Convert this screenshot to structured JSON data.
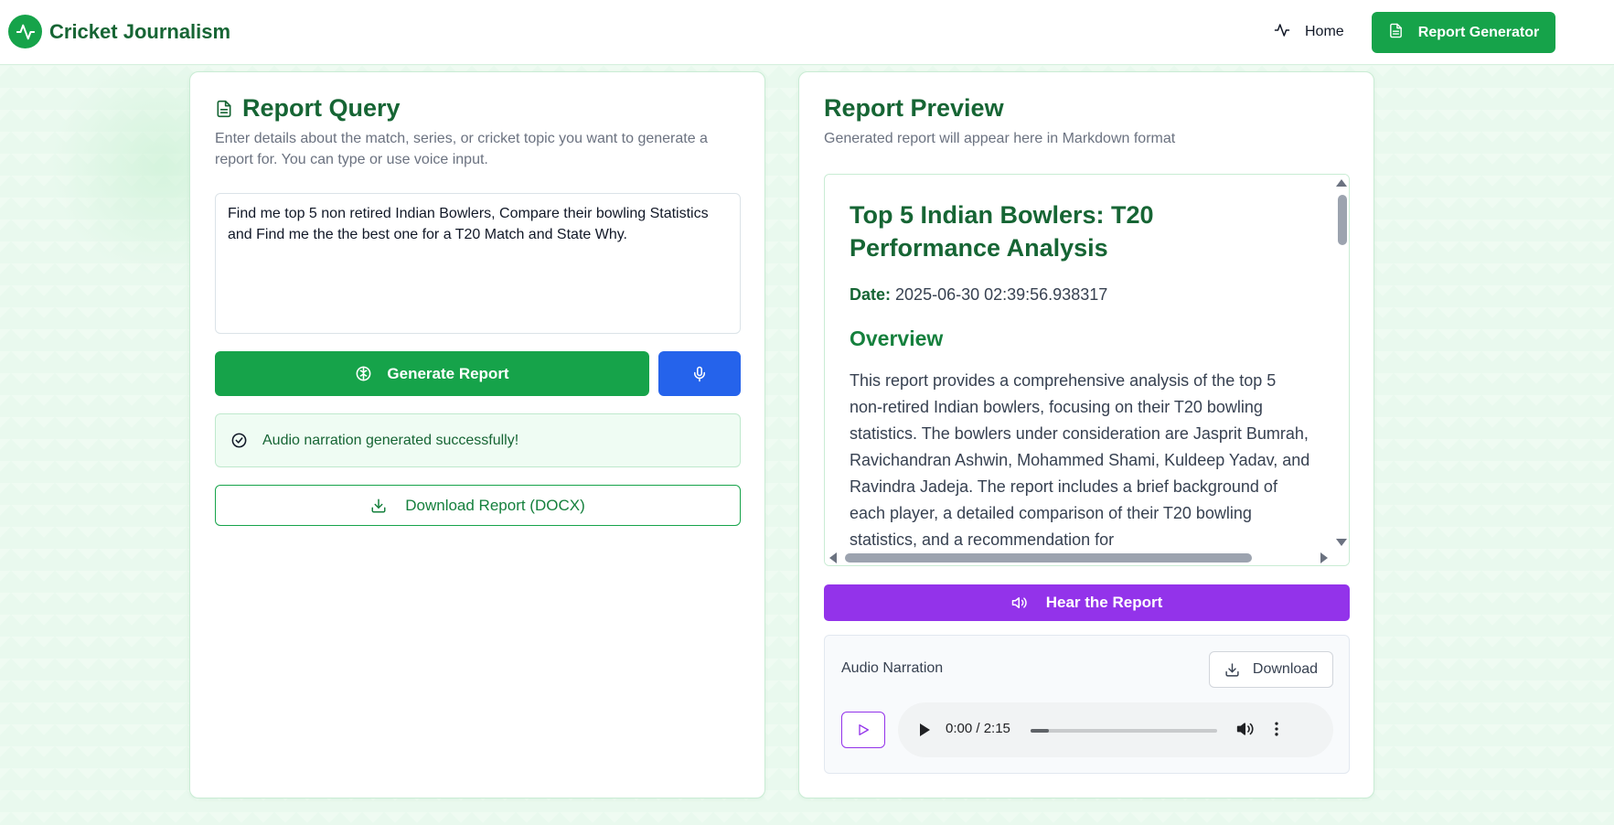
{
  "navbar": {
    "brand": "Cricket Journalism",
    "home_label": "Home",
    "generator_label": "Report Generator"
  },
  "query_card": {
    "title": "Report Query",
    "description": "Enter details about the match, series, or cricket topic you want to generate a report for. You can type or use voice input.",
    "query_value": "Find me top 5 non retired Indian Bowlers, Compare their bowling Statistics and Find me the the best one for a T20 Match and State Why.",
    "generate_label": "Generate Report",
    "success_message": "Audio narration generated successfully!",
    "download_docx_label": "Download Report (DOCX)"
  },
  "preview_card": {
    "title": "Report Preview",
    "description": "Generated report will appear here in Markdown format",
    "report": {
      "heading": "Top 5 Indian Bowlers: T20 Performance Analysis",
      "date_label": "Date:",
      "date_value": "2025-06-30 02:39:56.938317",
      "section_heading": "Overview",
      "paragraph": "This report provides a comprehensive analysis of the top 5 non-retired Indian bowlers, focusing on their T20 bowling statistics. The bowlers under consideration are Jasprit Bumrah, Ravichandran Ashwin, Mohammed Shami, Kuldeep Yadav, and Ravindra Jadeja. The report includes a brief background of each player, a detailed comparison of their T20 bowling statistics, and a recommendation for"
    },
    "hear_label": "Hear the Report",
    "audio": {
      "label": "Audio Narration",
      "download_label": "Download",
      "time_display": "0:00 / 2:15",
      "progress_fraction": 0.1
    }
  },
  "colors": {
    "primary_green": "#16a34a",
    "brand_text": "#166534",
    "mic_blue": "#2563eb",
    "hear_purple": "#9333ea"
  },
  "icons": {
    "brand": "activity-pulse-icon",
    "home": "activity-icon",
    "generator": "file-text-icon",
    "query_title": "file-text-icon",
    "generate": "brain-icon",
    "mic": "microphone-icon",
    "success": "check-circle-icon",
    "download": "download-icon",
    "hear": "volume-icon",
    "play": "play-icon",
    "volume": "speaker-icon",
    "more": "more-vertical-icon"
  }
}
